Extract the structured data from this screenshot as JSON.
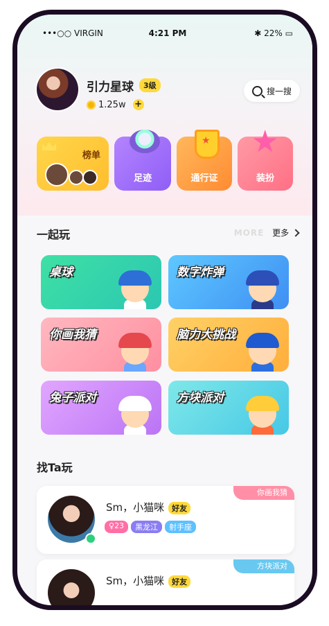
{
  "status_bar": {
    "carrier": "•••○○ VIRGIN",
    "time": "4:21 PM",
    "battery": "22%"
  },
  "profile": {
    "nickname": "引力星球",
    "level": "3级",
    "coins": "1.25w"
  },
  "search": {
    "label": "搜一搜"
  },
  "quick_tiles": [
    {
      "label": "榜单"
    },
    {
      "label": "足迹"
    },
    {
      "label": "通行证"
    },
    {
      "label": "装扮"
    }
  ],
  "play_together": {
    "title": "一起玩",
    "more_ghost": "MORE",
    "more_label": "更多"
  },
  "games": [
    {
      "title": "桌球",
      "accent": "#2cc7b2"
    },
    {
      "title": "数字炸弹",
      "accent": "#3f8ff3"
    },
    {
      "title": "你画我猜",
      "accent": "#ff8fa0"
    },
    {
      "title": "脑力大挑战",
      "accent": "#ffae3b"
    },
    {
      "title": "兔子派对",
      "accent": "#bb74f5"
    },
    {
      "title": "方块派对",
      "accent": "#46c8e6"
    }
  ],
  "find_ta": {
    "title": "找Ta玩"
  },
  "friends": [
    {
      "name": "Sm，小猫咪",
      "tag": "好友",
      "age": "23",
      "city": "黑龙江",
      "sign": "射手座",
      "game": "你画我猜"
    },
    {
      "name": "Sm，小猫咪",
      "tag": "好友",
      "game": "方块派对"
    }
  ],
  "icons": [
    "wifi-icon",
    "bluetooth-icon",
    "battery-icon",
    "coin-icon",
    "plus-icon",
    "search-icon",
    "chevron-right-icon",
    "female-icon"
  ]
}
